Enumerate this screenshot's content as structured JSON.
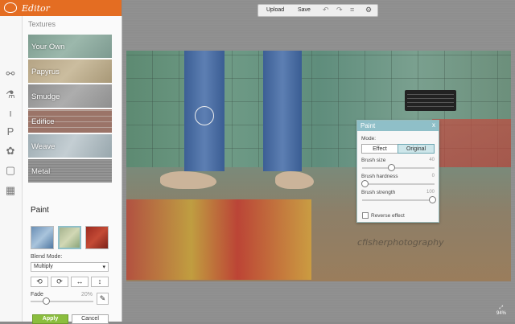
{
  "app": {
    "title": "Editor"
  },
  "toolbar": {
    "upload": "Upload",
    "save": "Save"
  },
  "panel": {
    "title": "Textures",
    "textures": [
      {
        "label": "Your Own",
        "color": "#8aa59a"
      },
      {
        "label": "Papyrus",
        "color": "#b9a88c"
      },
      {
        "label": "Smudge",
        "color": "#9d9d9d"
      },
      {
        "label": "Edifice",
        "color": "#9a7f72"
      },
      {
        "label": "Weave",
        "color": "#a9b4ba"
      },
      {
        "label": "Metal",
        "color": "#8c8c8c"
      }
    ],
    "paint_title": "Paint",
    "blend_label": "Blend Mode:",
    "blend_value": "Multiply",
    "fade_label": "Fade",
    "fade_value": "20%",
    "apply": "Apply",
    "cancel": "Cancel"
  },
  "popup": {
    "title": "Paint",
    "close": "x",
    "mode_label": "Mode:",
    "mode_effect": "Effect",
    "mode_original": "Original",
    "brush_size_label": "Brush size",
    "brush_size_value": "40",
    "brush_hardness_label": "Brush hardness",
    "brush_hardness_value": "0",
    "brush_strength_label": "Brush strength",
    "brush_strength_value": "100",
    "reverse_label": "Reverse effect"
  },
  "watermark": "cfisherphotography",
  "zoom": "94%",
  "colors": {
    "brand": "#e46d22",
    "accent": "#8fbfc8",
    "apply": "#8bbe3e"
  }
}
